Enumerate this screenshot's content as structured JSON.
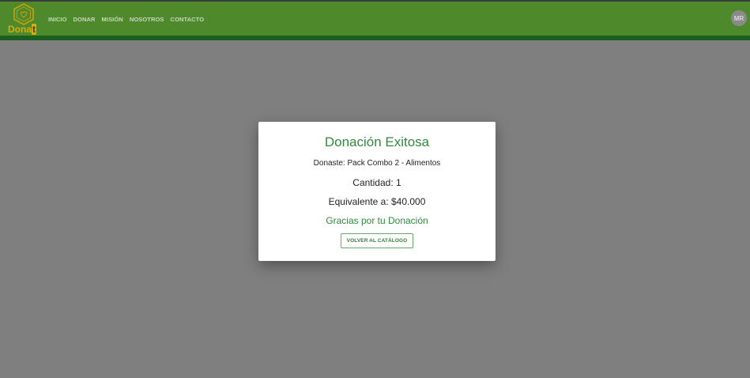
{
  "header": {
    "logo_text_main": "Dona",
    "logo_text_highlight": "t",
    "nav": [
      "INICIO",
      "DONAR",
      "MISIÓN",
      "NOSOTROS",
      "CONTACTO"
    ],
    "avatar_initials": "MR"
  },
  "modal": {
    "title": "Donación Exitosa",
    "product": "Donaste: Pack Combo 2 - Alimentos",
    "quantity": "Cantidad: 1",
    "equivalent": "Equivalente a: $40.000",
    "thanks": "Gracias por tu Donación",
    "back_button": "VOLVER AL CATÁLOGO"
  },
  "colors": {
    "header_bg": "#4e8a2b",
    "accent_green": "#2e8b3a",
    "logo_gold": "#d4ac0d",
    "overlay": "#7f7f7f"
  },
  "icons": {
    "logo": "hexagon-heart-logo-icon"
  }
}
